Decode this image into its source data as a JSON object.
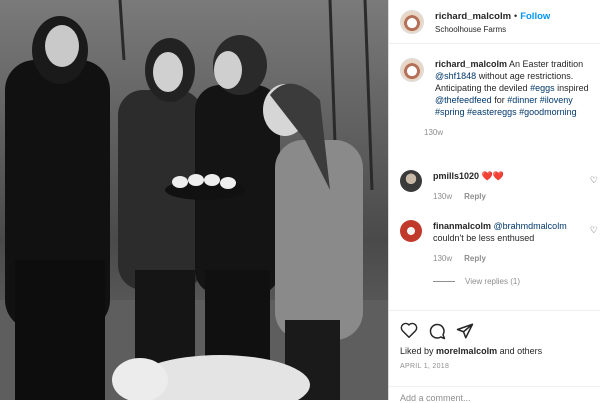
{
  "post": {
    "username": "richard_malcolm",
    "follow_label": "Follow",
    "location": "Schoolhouse Farms",
    "caption_user": "richard_malcolm",
    "caption_parts": {
      "p1": "An Easter tradition",
      "m1": "@shf1848",
      "p2": "without age restrictions. Anticipating the deviled",
      "h1": "#eggs",
      "p3": "inspired",
      "m2": "@thefeedfeed",
      "p4": "for",
      "h2": "#dinner",
      "h3": "#iloveny",
      "h4": "#spring",
      "h5": "#eastereggs",
      "h6": "#goodmorning"
    },
    "caption_age": "130w"
  },
  "comments": [
    {
      "user": "pmills1020",
      "text": "❤️❤️",
      "age": "130w",
      "reply": "Reply"
    },
    {
      "user": "finanmalcolm",
      "mention": "@brahmdmalcolm",
      "text": "couldn't be less enthused",
      "age": "130w",
      "reply": "Reply"
    }
  ],
  "view_replies": "View replies (1)",
  "likes_text": "Liked by",
  "likes_user": "morelmalcolm",
  "likes_suffix": "and others",
  "date": "APRIL 1, 2018",
  "add_comment_placeholder": "Add a comment..."
}
